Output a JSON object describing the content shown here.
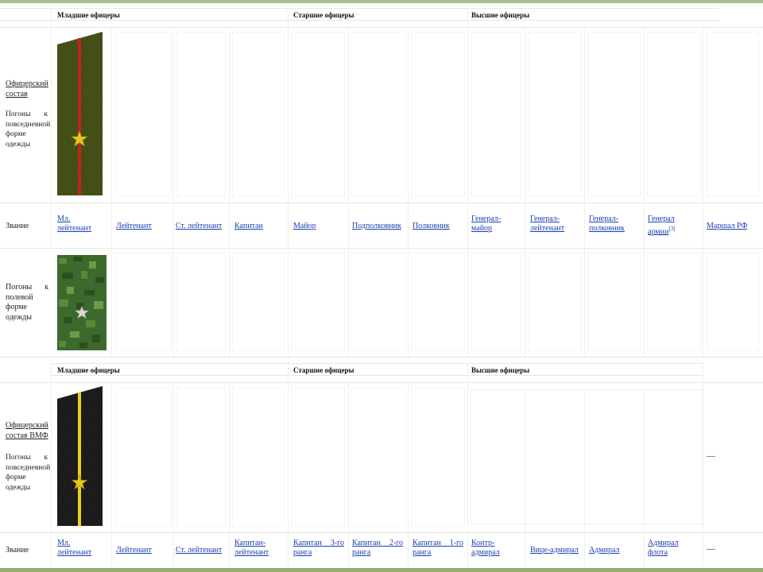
{
  "section1": {
    "headers": {
      "junior": "Младшие офицеры",
      "senior": "Старшие офицеры",
      "higher": "Высшие офицеры"
    },
    "officer_label": "Офицерский состав",
    "daily_label": "Погоны к повседневной форме одежды",
    "rank_label": "Звание",
    "field_label": "Погоны к полевой форме одежды",
    "ranks": [
      "Мл. лейтенант",
      "Лейтенант",
      "Ст. лейтенант",
      "Капитан",
      "Майор",
      "Подполковник",
      "Полковник",
      "Генерал-майор",
      "Генерал-лейтенант",
      "Генерал-полковник",
      "Генерал армии",
      "Маршал РФ"
    ],
    "footnote": "[3]"
  },
  "section2": {
    "headers": {
      "junior": "Младшие офицеры",
      "senior": "Старшие офицеры",
      "higher": "Высшие офицеры"
    },
    "officer_label": "Офицерский состав ВМФ",
    "daily_label": "Погоны к повседневной форме одежды",
    "rank_label": "Звание",
    "dash": "—",
    "ranks": [
      "Мл. лейтенант",
      "Лейтенант",
      "Ст. лейтенант",
      "Капитан-лейтенант",
      "Капитан 3-го ранга",
      "Капитан 2-го ранга",
      "Капитан 1-го ранга",
      "Контр-адмирал",
      "Вице-адмирал",
      "Адмирал",
      "Адмирал флота"
    ],
    "last_dash": "—"
  },
  "colors": {
    "link": "#1a3fb0",
    "army_strap": "#3e4a14",
    "army_stripe": "#c8201c",
    "navy_strap": "#151515",
    "navy_stripe": "#e8d21a",
    "star_gold": "#e7c51f",
    "field_camo": "#3b6a2c"
  },
  "icons": {
    "star": "star-icon"
  }
}
